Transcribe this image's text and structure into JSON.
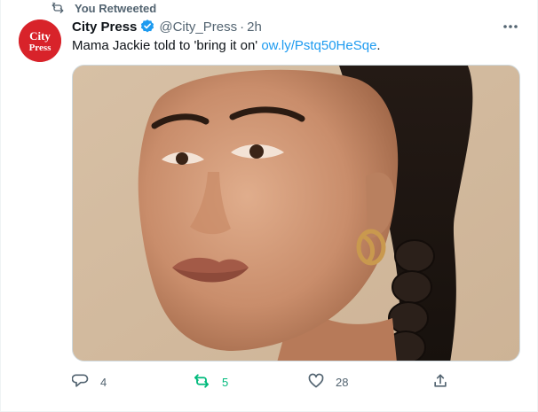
{
  "retweet_banner": {
    "label": "You Retweeted",
    "icon": "retweet-icon"
  },
  "tweet": {
    "author": {
      "display_name": "City Press",
      "handle": "@City_Press",
      "verified": true,
      "avatar_text_line1": "City",
      "avatar_text_line2": "Press",
      "avatar_color": "#d8232a"
    },
    "separator": "·",
    "time": "2h",
    "text": "Mama Jackie told to 'bring it on'",
    "link": "ow.ly/Pstq50HeSqe",
    "link_suffix": ".",
    "media_description": "Portrait of a woman with braided hair and gold twisted hoop earring",
    "stats": {
      "replies": "4",
      "retweets": "5",
      "likes": "28"
    }
  },
  "colors": {
    "accent": "#1d9bf0",
    "retweet_green": "#00ba7c",
    "muted": "#536471",
    "text": "#0f1419",
    "border": "#cfd9de"
  }
}
